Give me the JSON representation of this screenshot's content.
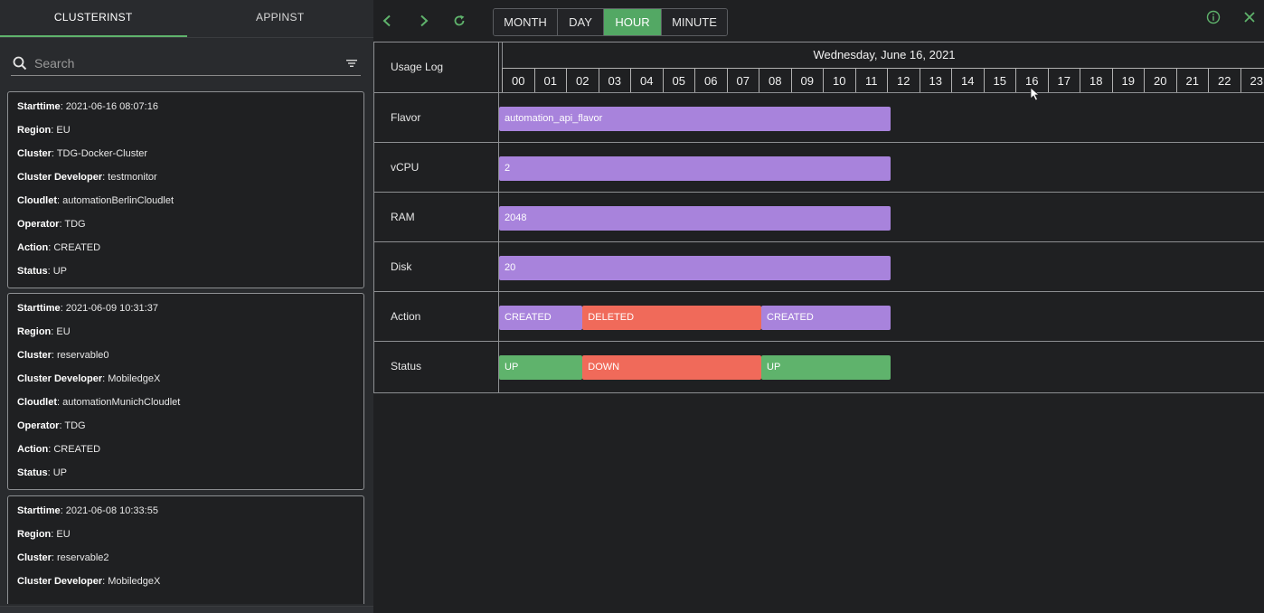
{
  "tabs": [
    {
      "label": "CLUSTERINST",
      "active": true
    },
    {
      "label": "APPINST",
      "active": false
    }
  ],
  "search": {
    "placeholder": "Search"
  },
  "cards": [
    {
      "rows": [
        {
          "label": "Starttime",
          "value": ": 2021-06-16 08:07:16"
        },
        {
          "label": "Region",
          "value": ": EU"
        },
        {
          "label": "Cluster",
          "value": ": TDG-Docker-Cluster"
        },
        {
          "label": "Cluster Developer",
          "value": ": testmonitor"
        },
        {
          "label": "Cloudlet",
          "value": ": automationBerlinCloudlet"
        },
        {
          "label": "Operator",
          "value": ": TDG"
        },
        {
          "label": "Action",
          "value": ": CREATED"
        },
        {
          "label": "Status",
          "value": ": UP"
        }
      ]
    },
    {
      "rows": [
        {
          "label": "Starttime",
          "value": ": 2021-06-09 10:31:37"
        },
        {
          "label": "Region",
          "value": ": EU"
        },
        {
          "label": "Cluster",
          "value": ": reservable0"
        },
        {
          "label": "Cluster Developer",
          "value": ": MobiledgeX"
        },
        {
          "label": "Cloudlet",
          "value": ": automationMunichCloudlet"
        },
        {
          "label": "Operator",
          "value": ": TDG"
        },
        {
          "label": "Action",
          "value": ": CREATED"
        },
        {
          "label": "Status",
          "value": ": UP"
        }
      ]
    },
    {
      "rows": [
        {
          "label": "Starttime",
          "value": ": 2021-06-08 10:33:55"
        },
        {
          "label": "Region",
          "value": ": EU"
        },
        {
          "label": "Cluster",
          "value": ": reservable2"
        },
        {
          "label": "Cluster Developer",
          "value": ": MobiledgeX"
        }
      ]
    }
  ],
  "toolbar": {
    "ranges": [
      {
        "label": "MONTH",
        "active": false
      },
      {
        "label": "DAY",
        "active": false
      },
      {
        "label": "HOUR",
        "active": true
      },
      {
        "label": "MINUTE",
        "active": false
      }
    ]
  },
  "timeline": {
    "header_label": "Usage Log",
    "date": "Wednesday, June 16, 2021",
    "hours": [
      "00",
      "01",
      "02",
      "03",
      "04",
      "05",
      "06",
      "07",
      "08",
      "09",
      "10",
      "11",
      "12",
      "13",
      "14",
      "15",
      "16",
      "17",
      "18",
      "19",
      "20",
      "21",
      "22",
      "23"
    ],
    "rows": [
      {
        "label": "Flavor",
        "bars": [
          {
            "text": "automation_api_flavor",
            "color": "purple",
            "start": 0,
            "end": 12.2
          }
        ]
      },
      {
        "label": "vCPU",
        "bars": [
          {
            "text": "2",
            "color": "purple",
            "start": 0,
            "end": 12.2
          }
        ]
      },
      {
        "label": "RAM",
        "bars": [
          {
            "text": "2048",
            "color": "purple",
            "start": 0,
            "end": 12.2
          }
        ]
      },
      {
        "label": "Disk",
        "bars": [
          {
            "text": "20",
            "color": "purple",
            "start": 0,
            "end": 12.2
          }
        ]
      },
      {
        "label": "Action",
        "bars": [
          {
            "text": "CREATED",
            "color": "purple",
            "start": 0,
            "end": 2.6
          },
          {
            "text": "DELETED",
            "color": "red",
            "start": 2.6,
            "end": 8.17
          },
          {
            "text": "CREATED",
            "color": "purple",
            "start": 8.17,
            "end": 12.2
          }
        ]
      },
      {
        "label": "Status",
        "bars": [
          {
            "text": "UP",
            "color": "green",
            "start": 0,
            "end": 2.6
          },
          {
            "text": "DOWN",
            "color": "red",
            "start": 2.6,
            "end": 8.17
          },
          {
            "text": "UP",
            "color": "green",
            "start": 8.17,
            "end": 12.2
          }
        ]
      }
    ]
  },
  "colors": {
    "accent": "#53a864",
    "purple": "#a883dc",
    "red": "#f06a5a",
    "green": "#5fb36c"
  },
  "icons": {
    "prev": "chevron-left-icon",
    "next": "chevron-right-icon",
    "refresh": "refresh-icon",
    "info": "info-icon",
    "close": "close-icon",
    "search": "search-icon",
    "filter": "filter-icon"
  }
}
